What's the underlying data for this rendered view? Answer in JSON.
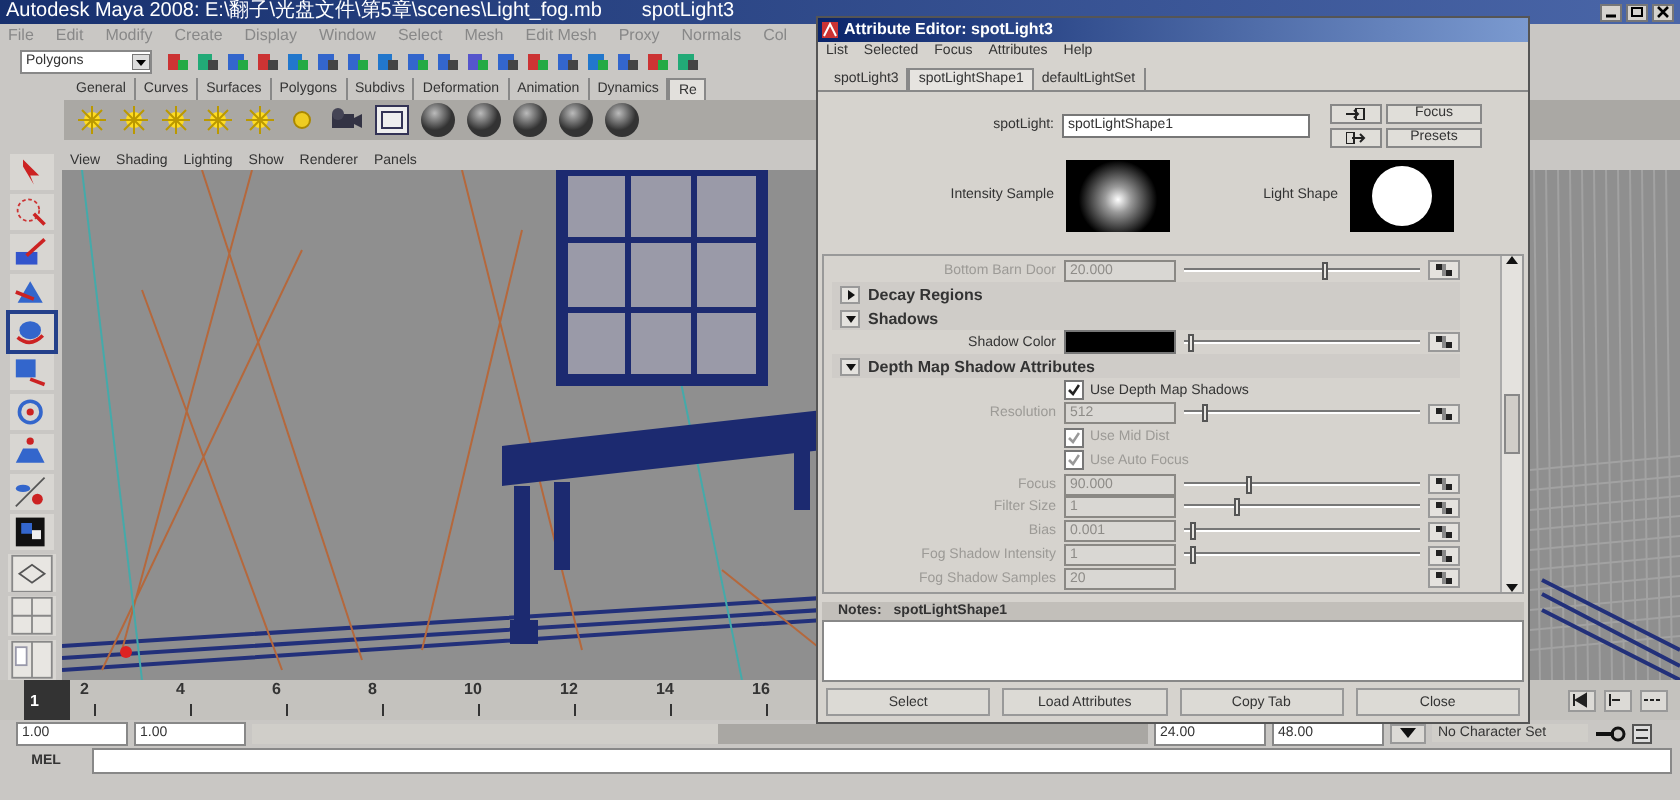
{
  "window": {
    "title": "Autodesk Maya 2008: E:\\翻子\\光盘文件\\第5章\\scenes\\Light_fog.mb",
    "title_right": "spotLight3"
  },
  "menu": [
    "File",
    "Edit",
    "Modify",
    "Create",
    "Display",
    "Window",
    "Select",
    "Mesh",
    "Edit Mesh",
    "Proxy",
    "Normals",
    "Col"
  ],
  "mode_dropdown": {
    "value": "Polygons"
  },
  "shelf_tabs": [
    {
      "label": "General",
      "selected": false
    },
    {
      "label": "Curves",
      "selected": false
    },
    {
      "label": "Surfaces",
      "selected": false
    },
    {
      "label": "Polygons",
      "selected": false
    },
    {
      "label": "Subdivs",
      "selected": false
    },
    {
      "label": "Deformation",
      "selected": false
    },
    {
      "label": "Animation",
      "selected": false
    },
    {
      "label": "Dynamics",
      "selected": false
    },
    {
      "label": "Re",
      "selected": true
    }
  ],
  "panel_menu": [
    "View",
    "Shading",
    "Lighting",
    "Show",
    "Renderer",
    "Panels"
  ],
  "attribute_editor": {
    "title": "Attribute Editor: spotLight3",
    "menu": [
      "List",
      "Selected",
      "Focus",
      "Attributes",
      "Help"
    ],
    "tabs": [
      {
        "label": "spotLight3",
        "selected": false
      },
      {
        "label": "spotLightShape1",
        "selected": true
      },
      {
        "label": "defaultLightSet",
        "selected": false
      }
    ],
    "node_label": "spotLight:",
    "node_name": "spotLightShape1",
    "focus_button": "Focus",
    "presets_button": "Presets",
    "intensity_label": "Intensity Sample",
    "shape_label": "Light Shape",
    "rows": [
      {
        "kind": "slider",
        "label": "Bottom Barn Door",
        "value": "20.000",
        "level": 0.6,
        "disabled": true
      },
      {
        "kind": "section",
        "label": "Decay Regions",
        "expanded": false
      },
      {
        "kind": "section",
        "label": "Shadows",
        "expanded": true
      },
      {
        "kind": "color",
        "label": "Shadow Color",
        "color": "#000000",
        "level": 0.02,
        "disabled": false
      },
      {
        "kind": "section",
        "label": "Depth Map Shadow Attributes",
        "expanded": true
      },
      {
        "kind": "checkbox",
        "label": "Use Depth Map Shadows",
        "checked": true,
        "disabled": false
      },
      {
        "kind": "slider",
        "label": "Resolution",
        "value": "512",
        "level": 0.08,
        "disabled": true
      },
      {
        "kind": "checkbox",
        "label": "Use Mid Dist",
        "checked": true,
        "disabled": true
      },
      {
        "kind": "checkbox",
        "label": "Use Auto Focus",
        "checked": true,
        "disabled": true
      },
      {
        "kind": "slider",
        "label": "Focus",
        "value": "90.000",
        "level": 0.27,
        "disabled": true
      },
      {
        "kind": "slider",
        "label": "Filter Size",
        "value": "1",
        "level": 0.22,
        "disabled": true
      },
      {
        "kind": "slider",
        "label": "Bias",
        "value": "0.001",
        "level": 0.03,
        "disabled": true
      },
      {
        "kind": "slider",
        "label": "Fog Shadow Intensity",
        "value": "1",
        "level": 0.03,
        "disabled": true
      },
      {
        "kind": "field",
        "label": "Fog Shadow Samples",
        "value": "20",
        "disabled": true
      }
    ],
    "notes_label": "Notes:",
    "notes_node": "spotLightShape1",
    "buttons": [
      "Select",
      "Load Attributes",
      "Copy Tab",
      "Close"
    ]
  },
  "timeline": {
    "current": "1",
    "labels": [
      "2",
      "4",
      "6",
      "8",
      "10",
      "12",
      "14",
      "16"
    ]
  },
  "range": {
    "level": 0.52,
    "start": "1.00",
    "inner_start": "1.00",
    "inner_end": "24.00",
    "end": "48.00"
  },
  "character_set": "No Character Set",
  "command_line": {
    "label": "MEL"
  }
}
